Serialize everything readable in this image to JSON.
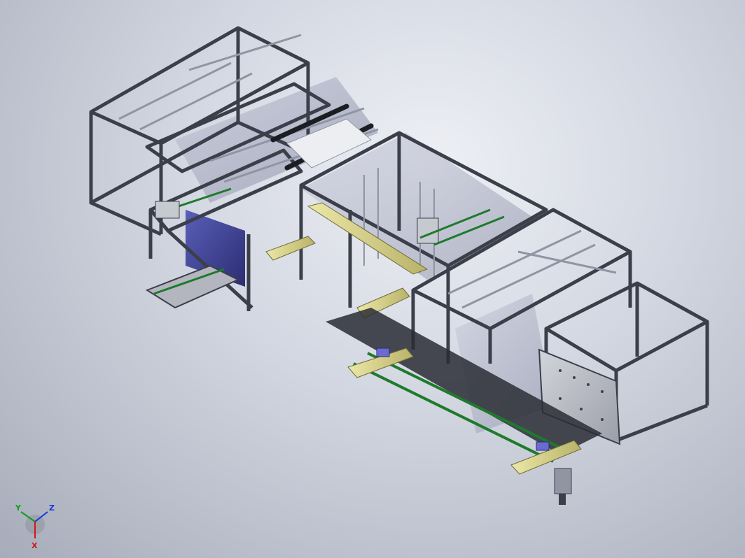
{
  "triad": {
    "x_label": "X",
    "y_label": "Y",
    "z_label": "Z",
    "x_color": "#d01818",
    "y_color": "#0e9c20",
    "z_color": "#1638d8"
  },
  "colors": {
    "frame": "#3b3f49",
    "frame_light": "#8f95a3",
    "panel": "#aeb2c7",
    "panel_dark": "#3e3f8e",
    "rail_green": "#1e7a2c",
    "slide_yellow": "#d7d38f",
    "block_blue": "#6a6ad0",
    "plate": "#b3b6bf"
  },
  "icons": {
    "triad": "coordinate-triad-icon"
  }
}
